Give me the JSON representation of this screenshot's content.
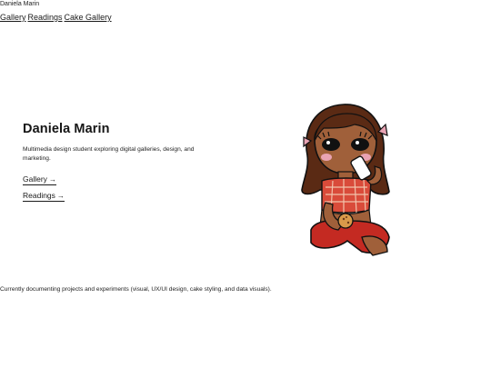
{
  "site": {
    "name": "Daniela Marin"
  },
  "nav": {
    "items": [
      {
        "label": "Gallery"
      },
      {
        "label": "Readings"
      },
      {
        "label": "Cake Gallery"
      }
    ]
  },
  "hero": {
    "title": "Daniela Marin",
    "description": "Multimedia design student exploring digital galleries, design, and marketing.",
    "links": [
      {
        "label": "Gallery",
        "icon": "arrow-right-icon"
      },
      {
        "label": "Readings",
        "icon": "arrow-right-icon"
      }
    ]
  },
  "illustration": {
    "icon": "avatar-illustration"
  },
  "status": {
    "text": "Currently documenting projects and experiments (visual, UX/UI design, cake styling, and data visuals)."
  },
  "colors": {
    "text": "#1a1a1a",
    "hair": "#5a2a14",
    "skin": "#a0603a",
    "top": "#d94b3a",
    "shorts": "#c42a22",
    "bow": "#e9a3b3"
  }
}
